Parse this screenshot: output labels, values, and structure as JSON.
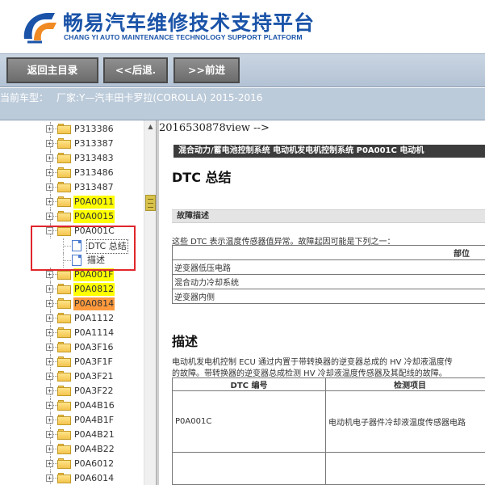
{
  "header": {
    "title": "畅易汽车维修技术支持平台",
    "subtitle": "CHANG YI AUTO MAINTENANCE TECHNOLOGY SUPPORT PLATFORM",
    "brand_color": "#1a53a8",
    "logo_accent": "#f08a24"
  },
  "nav": {
    "home_label": "返回主目录",
    "back_label": "<<后退.",
    "forward_label": ">>前进"
  },
  "car": {
    "label": "当前车型：",
    "value": "厂家:Y—汽丰田卡罗拉(COROLLA) 2015-2016"
  },
  "tree": {
    "items_top": [
      {
        "code": "P313386",
        "highlight": "none"
      },
      {
        "code": "P313387",
        "highlight": "none"
      },
      {
        "code": "P313483",
        "highlight": "none"
      },
      {
        "code": "P313486",
        "highlight": "none"
      },
      {
        "code": "P313487",
        "highlight": "none"
      },
      {
        "code": "P0A0011",
        "highlight": "yellow"
      },
      {
        "code": "P0A0015",
        "highlight": "yellow"
      },
      {
        "code": "P0A001C",
        "highlight": "selected"
      }
    ],
    "children": [
      {
        "label": "DTC 总结",
        "selected": true
      },
      {
        "label": "描述",
        "selected": false
      }
    ],
    "items_bottom": [
      {
        "code": "P0A001F",
        "highlight": "yellow"
      },
      {
        "code": "P0A0812",
        "highlight": "yellow"
      },
      {
        "code": "P0A0814",
        "highlight": "orange"
      },
      {
        "code": "P0A1112",
        "highlight": "none"
      },
      {
        "code": "P0A1114",
        "highlight": "none"
      },
      {
        "code": "P0A3F16",
        "highlight": "none"
      },
      {
        "code": "P0A3F1F",
        "highlight": "none"
      },
      {
        "code": "P0A3F21",
        "highlight": "none"
      },
      {
        "code": "P0A3F22",
        "highlight": "none"
      },
      {
        "code": "P0A4B16",
        "highlight": "none"
      },
      {
        "code": "P0A4B1F",
        "highlight": "none"
      },
      {
        "code": "P0A4B21",
        "highlight": "none"
      },
      {
        "code": "P0A4B22",
        "highlight": "none"
      },
      {
        "code": "P0A6012",
        "highlight": "none"
      },
      {
        "code": "P0A6014",
        "highlight": "none"
      }
    ]
  },
  "content": {
    "comment": "2016530878view -->",
    "breadcrumb": "混合动力/蓄电池控制系统  电动机发电机控制系统  P0A001C  电动机",
    "heading1": "DTC 总结",
    "section1": "故障描述",
    "para1": "这些 DTC 表示温度传感器值异常。故障起因可能是下列之一：",
    "table1": {
      "header": "部位",
      "rows": [
        "逆变器低压电路",
        "混合动力冷却系统",
        "逆变器内侧"
      ]
    },
    "heading2": "描述",
    "para2": "电动机发电机控制 ECU 通过内置于带转换器的逆变器总成的 HV 冷却液温度传",
    "para3": "的故障。带转换器的逆变器总成检测 HV 冷却液温度传感器及其配线的故障。",
    "table2": {
      "col1": "DTC 编号",
      "col2": "检测项目",
      "rows": [
        {
          "code": "P0A001C",
          "item": "电动机电子器件冷却液温度传感器电路"
        }
      ]
    }
  }
}
